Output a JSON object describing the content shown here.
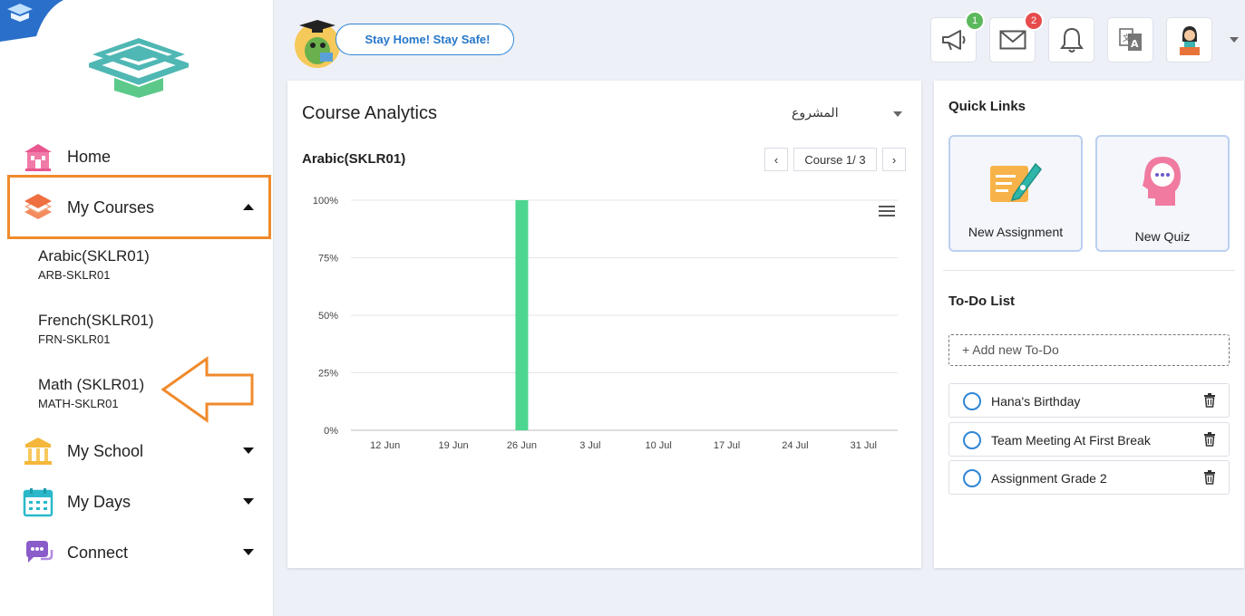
{
  "sidebar": {
    "nav": {
      "home": "Home",
      "my_courses": "My Courses",
      "my_school": "My School",
      "my_days": "My Days",
      "connect": "Connect"
    },
    "courses": [
      {
        "name": "Arabic(SKLR01)",
        "code": "ARB-SKLR01"
      },
      {
        "name": "French(SKLR01)",
        "code": "FRN-SKLR01"
      },
      {
        "name": "Math (SKLR01)",
        "code": "MATH-SKLR01"
      }
    ]
  },
  "header": {
    "banner": "Stay Home! Stay Safe!",
    "badges": {
      "announcements": "1",
      "messages": "2"
    }
  },
  "analytics": {
    "title": "Course Analytics",
    "dropdown_value": "المشروع",
    "course_label": "Arabic(SKLR01)",
    "pager": {
      "prev": "‹",
      "label": "Course 1/ 3",
      "next": "›"
    }
  },
  "chart_data": {
    "type": "bar",
    "categories": [
      "12 Jun",
      "19 Jun",
      "26 Jun",
      "3 Jul",
      "10 Jul",
      "17 Jul",
      "24 Jul",
      "31 Jul"
    ],
    "values": [
      0,
      0,
      100,
      0,
      0,
      0,
      0,
      0
    ],
    "y_ticks": [
      "0%",
      "25%",
      "50%",
      "75%",
      "100%"
    ],
    "ylim": [
      0,
      100
    ],
    "grid": true,
    "color": "#4cd68f"
  },
  "quick_links": {
    "title": "Quick Links",
    "new_assignment": "New Assignment",
    "new_quiz": "New Quiz"
  },
  "todo": {
    "title": "To-Do List",
    "placeholder": "+ Add new To-Do",
    "items": [
      {
        "text": "Hana's Birthday"
      },
      {
        "text": "Team Meeting At First Break"
      },
      {
        "text": "Assignment Grade 2"
      }
    ]
  },
  "colors": {
    "accent_orange": "#f08a2c",
    "primary_blue": "#2f86d6",
    "bar_green": "#4cd68f",
    "badge_green": "#5cb85c",
    "badge_red": "#e74c4c"
  }
}
